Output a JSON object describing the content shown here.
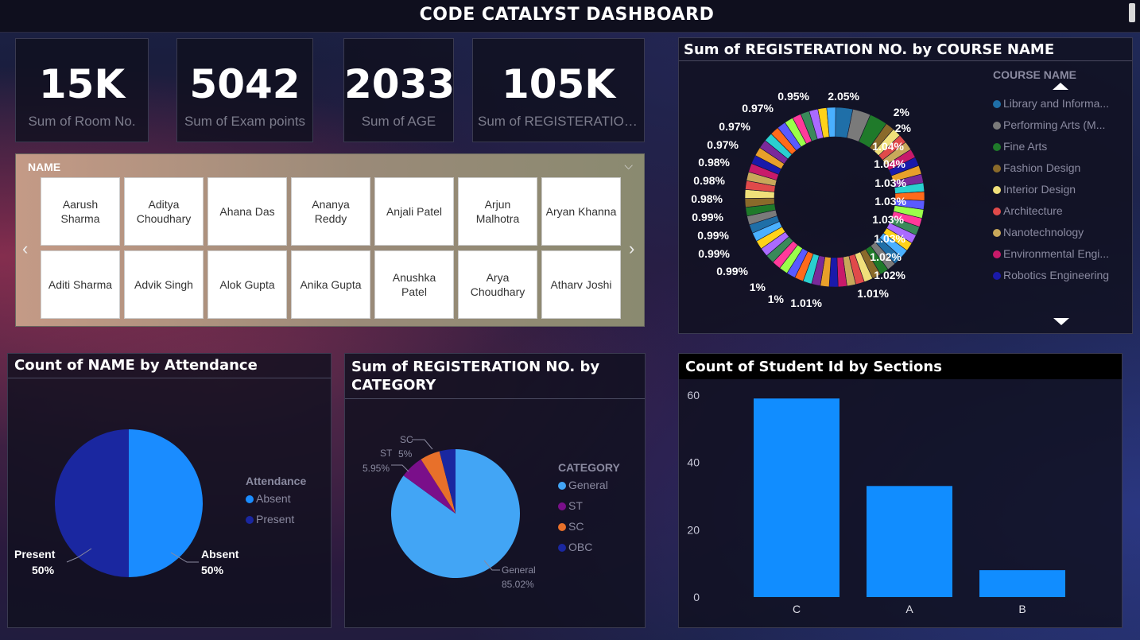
{
  "header": {
    "title": "CODE CATALYST DASHBOARD"
  },
  "kpis": [
    {
      "value": "15K",
      "label": "Sum of Room No."
    },
    {
      "value": "5042",
      "label": "Sum of Exam points"
    },
    {
      "value": "2033",
      "label": "Sum of AGE"
    },
    {
      "value": "105K",
      "label": "Sum of REGISTERATION..."
    }
  ],
  "name_slicer": {
    "title": "NAME",
    "names": [
      "Aarush Sharma",
      "Aditya Choudhary",
      "Ahana Das",
      "Ananya Reddy",
      "Anjali Patel",
      "Arjun Malhotra",
      "Aryan Khanna",
      "Aditi Sharma",
      "Advik Singh",
      "Alok Gupta",
      "Anika Gupta",
      "Anushka Patel",
      "Arya Choudhary",
      "Atharv Joshi"
    ]
  },
  "donut": {
    "title": "Sum of REGISTERATION NO. by COURSE NAME",
    "legend_title": "COURSE NAME",
    "legend": [
      {
        "label": "Library and Informa...",
        "color": "#1f6fa8"
      },
      {
        "label": "Performing Arts (M...",
        "color": "#7a7a7a"
      },
      {
        "label": "Fine Arts",
        "color": "#1f7a2a"
      },
      {
        "label": "Fashion Design",
        "color": "#8a6a2a"
      },
      {
        "label": "Interior Design",
        "color": "#f0e07a"
      },
      {
        "label": "Architecture",
        "color": "#e04a4a"
      },
      {
        "label": "Nanotechnology",
        "color": "#c8a85a"
      },
      {
        "label": "Environmental Engi...",
        "color": "#c81a6a"
      },
      {
        "label": "Robotics Engineering",
        "color": "#1a1aaa"
      }
    ],
    "labels_right": [
      "2.05%",
      "2%",
      "2%",
      "1.04%",
      "1.04%",
      "1.03%",
      "1.03%",
      "1.03%",
      "1.03%",
      "1.02%",
      "1.02%",
      "1.01%"
    ],
    "labels_left": [
      "0.95%",
      "0.97%",
      "0.97%",
      "0.97%",
      "0.98%",
      "0.98%",
      "0.98%",
      "0.99%",
      "0.99%",
      "0.99%",
      "0.99%",
      "1%",
      "1%",
      "1.01%"
    ]
  },
  "attendance": {
    "title": "Count of NAME by Attendance",
    "legend_title": "Attendance",
    "items": [
      {
        "label": "Absent",
        "color": "#1a8cff"
      },
      {
        "label": "Present",
        "color": "#1a27a0"
      }
    ],
    "slice_labels": {
      "present_name": "Present",
      "present_pct": "50%",
      "absent_name": "Absent",
      "absent_pct": "50%"
    }
  },
  "category": {
    "title_line1": "Sum of REGISTERATION NO. by",
    "title_line2": "CATEGORY",
    "legend_title": "CATEGORY",
    "items": [
      {
        "label": "General",
        "color": "#42a5f5"
      },
      {
        "label": "ST",
        "color": "#7a0f8a"
      },
      {
        "label": "SC",
        "color": "#e8702a"
      },
      {
        "label": "OBC",
        "color": "#1a27a0"
      }
    ],
    "slice_labels": {
      "general_name": "General",
      "general_pct": "85.02%",
      "st_name": "ST",
      "st_pct": "5.95%",
      "sc_name": "SC",
      "sc_pct": "5%"
    }
  },
  "sections": {
    "title": "Count of Student Id by Sections",
    "y_ticks": [
      "60",
      "40",
      "20",
      "0"
    ]
  },
  "chart_data": [
    {
      "type": "pie",
      "title": "Count of NAME by Attendance",
      "categories": [
        "Absent",
        "Present"
      ],
      "values": [
        50,
        50
      ],
      "legend": "right"
    },
    {
      "type": "pie",
      "title": "Sum of REGISTERATION NO. by CATEGORY",
      "categories": [
        "General",
        "ST",
        "SC",
        "OBC"
      ],
      "values": [
        85.02,
        5.95,
        5.0,
        4.03
      ],
      "legend": "right"
    },
    {
      "type": "bar",
      "title": "Count of Student Id by Sections",
      "categories": [
        "C",
        "A",
        "B"
      ],
      "values": [
        59,
        33,
        8
      ],
      "ylim": [
        0,
        60
      ],
      "xlabel": "",
      "ylabel": "",
      "color": "#118dff"
    }
  ]
}
